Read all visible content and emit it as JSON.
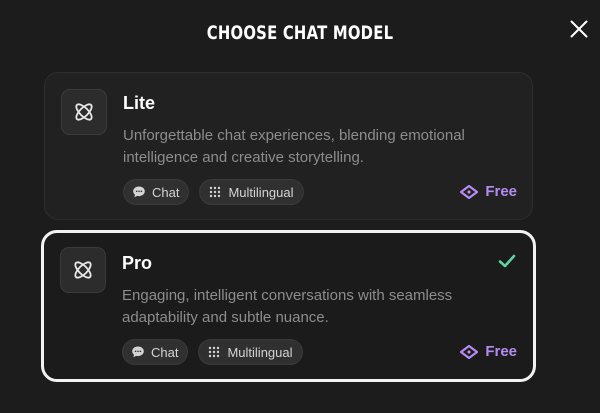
{
  "modal": {
    "title": "CHOOSE CHAT MODEL"
  },
  "models": [
    {
      "name": "Lite",
      "description": "Unforgettable chat experiences, blending emotional intelligence and creative storytelling.",
      "tags": [
        {
          "label": "Chat",
          "icon": "chat-bubble-icon"
        },
        {
          "label": "Multilingual",
          "icon": "dots-grid-icon"
        }
      ],
      "price": "Free",
      "selected": false
    },
    {
      "name": "Pro",
      "description": "Engaging, intelligent conversations with seamless adaptability and subtle nuance.",
      "tags": [
        {
          "label": "Chat",
          "icon": "chat-bubble-icon"
        },
        {
          "label": "Multilingual",
          "icon": "dots-grid-icon"
        }
      ],
      "price": "Free",
      "selected": true
    }
  ],
  "colors": {
    "background": "#1c1c1c",
    "price_accent": "#b48cf2",
    "check_accent": "#5fd3a1",
    "selected_border": "#f2f2f2"
  }
}
